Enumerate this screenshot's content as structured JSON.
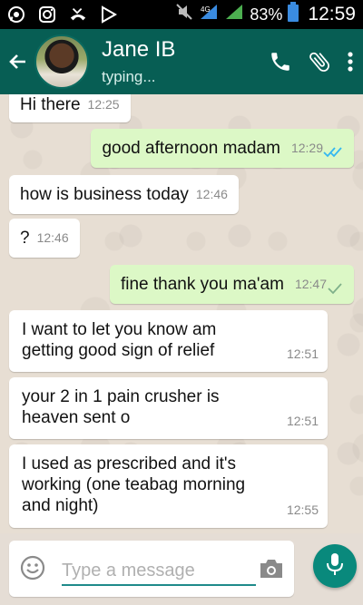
{
  "status_bar": {
    "battery_percent": "83%",
    "time": "12:59",
    "icons": [
      "whatsapp-icon",
      "instagram-icon",
      "missed-call-icon",
      "play-store-icon",
      "mute-icon",
      "signal-icon",
      "signal-icon",
      "battery-icon"
    ]
  },
  "header": {
    "contact_name": "Jane IB",
    "status": "typing...",
    "icons": [
      "back-arrow-icon",
      "phone-icon",
      "attach-icon",
      "more-icon"
    ],
    "color": "#075e54"
  },
  "messages": [
    {
      "dir": "in",
      "text": "Hi there",
      "time": "12:25"
    },
    {
      "dir": "out",
      "text": "good afternoon madam",
      "time": "12:29",
      "ticks": "double-blue"
    },
    {
      "dir": "in",
      "text": "how is business today",
      "time": "12:46"
    },
    {
      "dir": "in",
      "text": "?",
      "time": "12:46"
    },
    {
      "dir": "out",
      "text": "fine thank you ma'am",
      "time": "12:47",
      "ticks": "single-grey"
    },
    {
      "dir": "in",
      "text": "I want to let you know am getting good sign of relief",
      "time": "12:51"
    },
    {
      "dir": "in",
      "text": "your 2 in 1 pain crusher is heaven sent o",
      "time": "12:51"
    },
    {
      "dir": "in",
      "text": "I used as prescribed and it's working (one teabag morning and night)",
      "time": "12:55"
    }
  ],
  "input": {
    "placeholder": "Type a message",
    "value": ""
  },
  "colors": {
    "incoming_bubble": "#ffffff",
    "outgoing_bubble": "#dcf8c6",
    "read_tick": "#34b7f1",
    "mic_button": "#09897c"
  }
}
